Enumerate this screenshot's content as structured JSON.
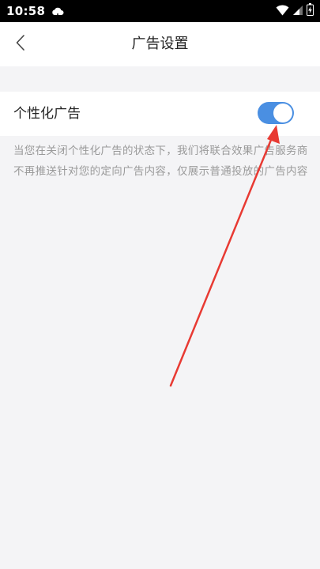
{
  "status_bar": {
    "time": "10:58",
    "icons": [
      "cloud-icon",
      "wifi-icon",
      "signal-icon",
      "battery-icon"
    ],
    "background": "#000000"
  },
  "header": {
    "title": "广告设置",
    "back_icon": "chevron-left-icon"
  },
  "settings": {
    "personalized_ads": {
      "label": "个性化广告",
      "enabled": true,
      "accent_color": "#4a8fe2"
    },
    "description": "当您在关闭个性化广告的状态下，我们将联合效果广告服务商不再推送针对您的定向广告内容，仅展示普通投放的广告内容"
  },
  "annotation": {
    "type": "arrow",
    "color": "#e83a33",
    "points_to": "personalized-ads-toggle"
  }
}
